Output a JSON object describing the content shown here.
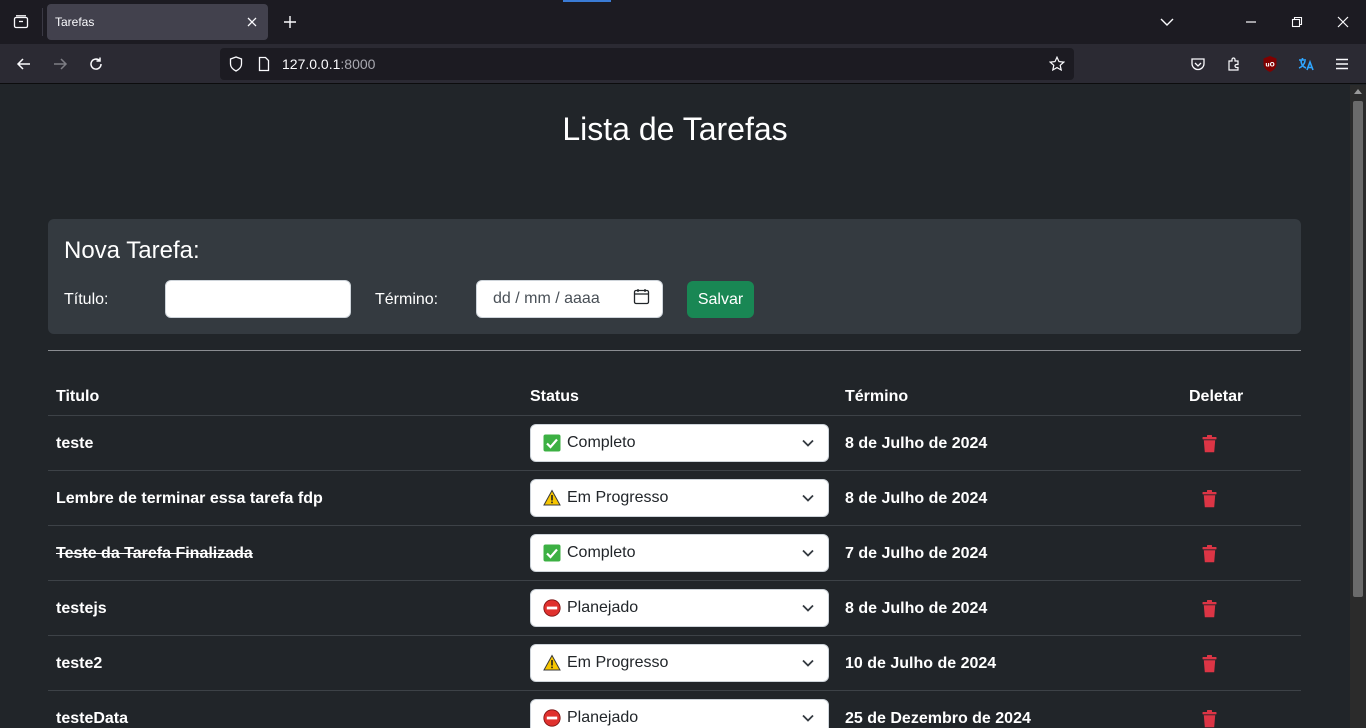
{
  "browser": {
    "tab_title": "Tarefas",
    "url_host": "127.0.0.1",
    "url_port": ":8000"
  },
  "page": {
    "title": "Lista de Tarefas"
  },
  "form": {
    "heading": "Nova Tarefa:",
    "title_label": "Título:",
    "title_value": "",
    "end_label": "Término:",
    "date_placeholder": "dd / mm / aaaa",
    "save_label": "Salvar"
  },
  "table": {
    "headers": [
      "Titulo",
      "Status",
      "Término",
      "Deletar"
    ],
    "rows": [
      {
        "title": "teste",
        "status": "Completo",
        "status_icon": "check-icon",
        "date": "8 de Julho de 2024",
        "done": false
      },
      {
        "title": "Lembre de terminar essa tarefa fdp",
        "status": "Em Progresso",
        "status_icon": "warning-icon",
        "date": "8 de Julho de 2024",
        "done": false
      },
      {
        "title": "Teste da Tarefa Finalizada",
        "status": "Completo",
        "status_icon": "check-icon",
        "date": "7 de Julho de 2024",
        "done": true
      },
      {
        "title": "testejs",
        "status": "Planejado",
        "status_icon": "no-entry-icon",
        "date": "8 de Julho de 2024",
        "done": false
      },
      {
        "title": "teste2",
        "status": "Em Progresso",
        "status_icon": "warning-icon",
        "date": "10 de Julho de 2024",
        "done": false
      },
      {
        "title": "testeData",
        "status": "Planejado",
        "status_icon": "no-entry-icon",
        "date": "25 de Dezembro de 2024",
        "done": false
      }
    ]
  },
  "colors": {
    "page_bg": "#212529",
    "card_bg": "#343a40",
    "save_button": "#198754",
    "delete_icon": "#dc3545"
  }
}
